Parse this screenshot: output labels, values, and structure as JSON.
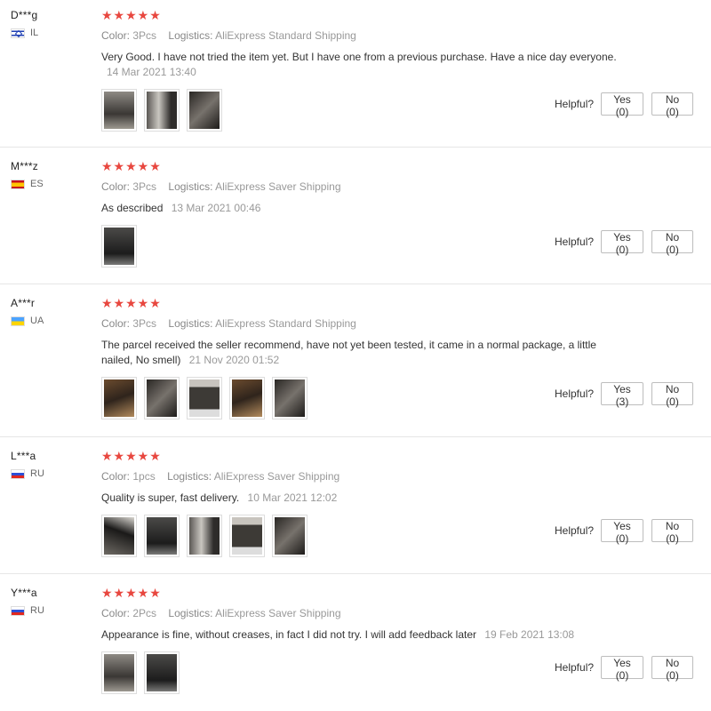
{
  "labels": {
    "color": "Color:",
    "logistics": "Logistics:",
    "helpful": "Helpful?"
  },
  "star_color": "#e8473f",
  "reviews": [
    {
      "user": "D***g",
      "country": "IL",
      "rating": 5,
      "stars": "★★★★★",
      "color": "3Pcs",
      "logistics": "AliExpress Standard Shipping",
      "text": "Very Good. I have not tried the item yet. But I have one from a previous purchase. Have a nice day everyone.",
      "date": "14 Mar 2021 13:40",
      "photo_count": 3,
      "yes": "Yes (0)",
      "no": "No (0)"
    },
    {
      "user": "M***z",
      "country": "ES",
      "rating": 5,
      "stars": "★★★★★",
      "color": "3Pcs",
      "logistics": "AliExpress Saver Shipping",
      "text": "As described",
      "date": "13 Mar 2021 00:46",
      "photo_count": 1,
      "yes": "Yes (0)",
      "no": "No (0)"
    },
    {
      "user": "A***r",
      "country": "UA",
      "rating": 5,
      "stars": "★★★★★",
      "color": "3Pcs",
      "logistics": "AliExpress Standard Shipping",
      "text": "The parcel received the seller recommend, have not yet been tested, it came in a normal package, a little nailed, No smell)",
      "date": "21 Nov 2020 01:52",
      "photo_count": 5,
      "yes": "Yes (3)",
      "no": "No (0)"
    },
    {
      "user": "L***a",
      "country": "RU",
      "rating": 5,
      "stars": "★★★★★",
      "color": "1pcs",
      "logistics": "AliExpress Saver Shipping",
      "text": "Quality is super, fast delivery.",
      "date": "10 Mar 2021 12:02",
      "photo_count": 5,
      "yes": "Yes (0)",
      "no": "No (0)"
    },
    {
      "user": "Y***a",
      "country": "RU",
      "rating": 5,
      "stars": "★★★★★",
      "color": "2Pcs",
      "logistics": "AliExpress Saver Shipping",
      "text": "Appearance is fine, without creases, in fact I did not try. I will add feedback later",
      "date": "19 Feb 2021 13:08",
      "photo_count": 2,
      "yes": "Yes (0)",
      "no": "No (0)"
    }
  ]
}
